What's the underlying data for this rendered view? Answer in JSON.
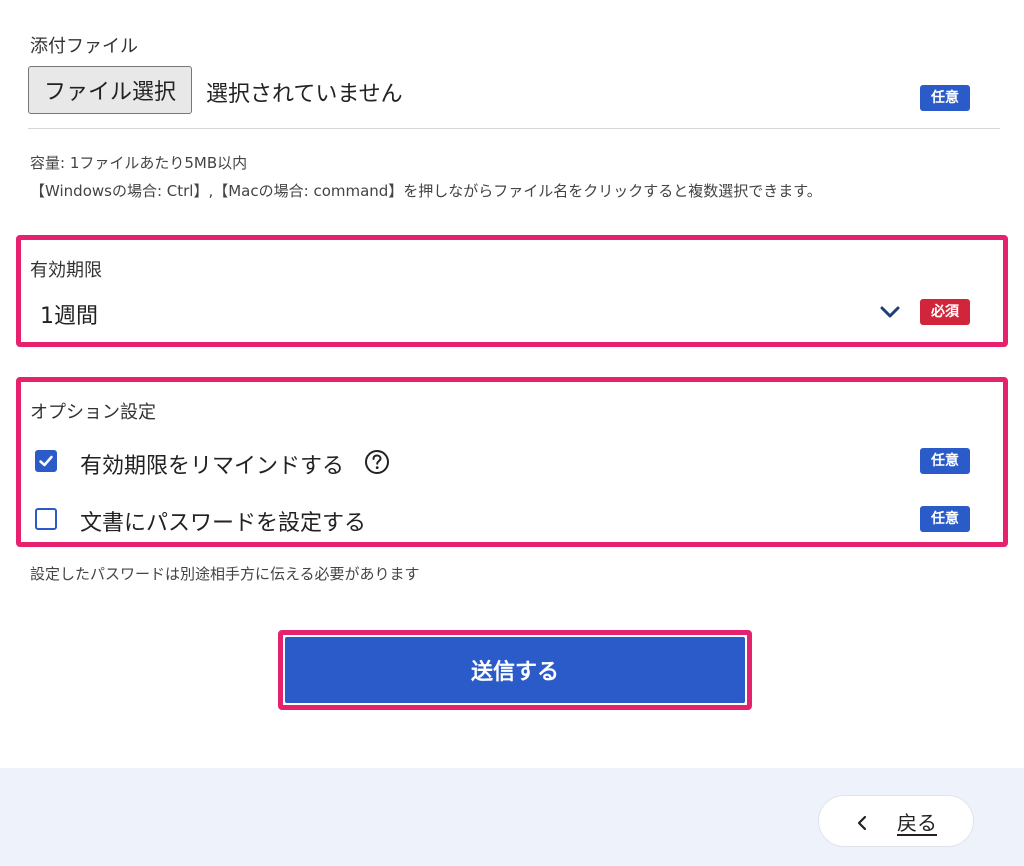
{
  "attachment": {
    "label": "添付ファイル",
    "choose_button": "ファイル選択",
    "status": "選択されていません",
    "badge": "任意",
    "note_capacity": "容量: 1ファイルあたり5MB以内",
    "note_multiselect": "【Windowsの場合: Ctrl】,【Macの場合: command】を押しながらファイル名をクリックすると複数選択できます。"
  },
  "expiry": {
    "label": "有効期限",
    "selected": "1週間",
    "badge": "必須"
  },
  "options": {
    "label": "オプション設定",
    "items": [
      {
        "label": "有効期限をリマインドする",
        "checked": true,
        "badge": "任意"
      },
      {
        "label": "文書にパスワードを設定する",
        "checked": false,
        "badge": "任意"
      }
    ],
    "note": "設定したパスワードは別途相手方に伝える必要があります"
  },
  "submit": {
    "label": "送信する"
  },
  "footer": {
    "back_label": "戻る"
  },
  "colors": {
    "primary": "#2a5bc8",
    "required": "#d0253a",
    "highlight": "#e6226e",
    "footer_bg": "#eef3fb"
  }
}
